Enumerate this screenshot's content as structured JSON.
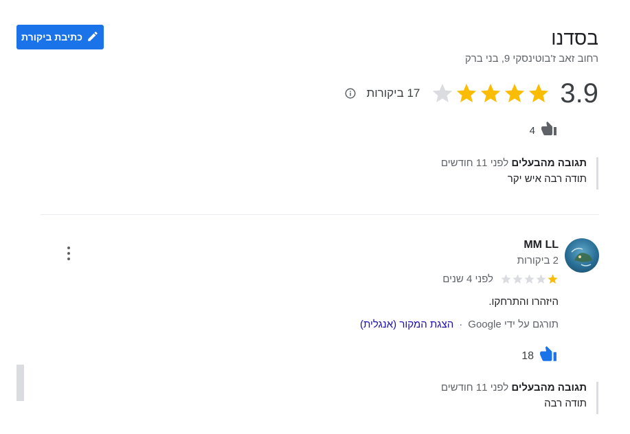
{
  "header": {
    "write_review_label": "כתיבת ביקורת",
    "business_name": "בסדנו",
    "address": "רחוב זאב ז'בוטינסקי 9, בני ברק"
  },
  "summary": {
    "rating": "3.9",
    "stars_filled": 4,
    "stars_total": 5,
    "review_count_label": "17 ביקורות"
  },
  "previous_review": {
    "likes": "4",
    "owner_reply": {
      "title": "תגובה מהבעלים",
      "time": "לפני 11 חודשים",
      "text": "תודה רבה איש יקר"
    }
  },
  "review": {
    "reviewer_name": "MM LL",
    "reviewer_review_count": "2 ביקורות",
    "stars_filled": 1,
    "stars_total": 5,
    "time": "לפני 4 שנים",
    "text": "היזהרו והתרחקו.",
    "translated_by": "תורגם על ידי Google",
    "separator": "·",
    "show_original": "הצגת המקור (אנגלית)",
    "likes": "18",
    "owner_reply": {
      "title": "תגובה מהבעלים",
      "time": "לפני 11 חודשים",
      "text": "תודה רבה"
    }
  },
  "colors": {
    "accent": "#1a73e8",
    "star_filled": "#fbbc04",
    "star_empty": "#dadce0",
    "link": "#1a0dab"
  },
  "icons": {
    "edit": "pencil-icon",
    "info": "info-icon",
    "like": "thumbs-up-icon",
    "menu": "more-vert-icon"
  }
}
